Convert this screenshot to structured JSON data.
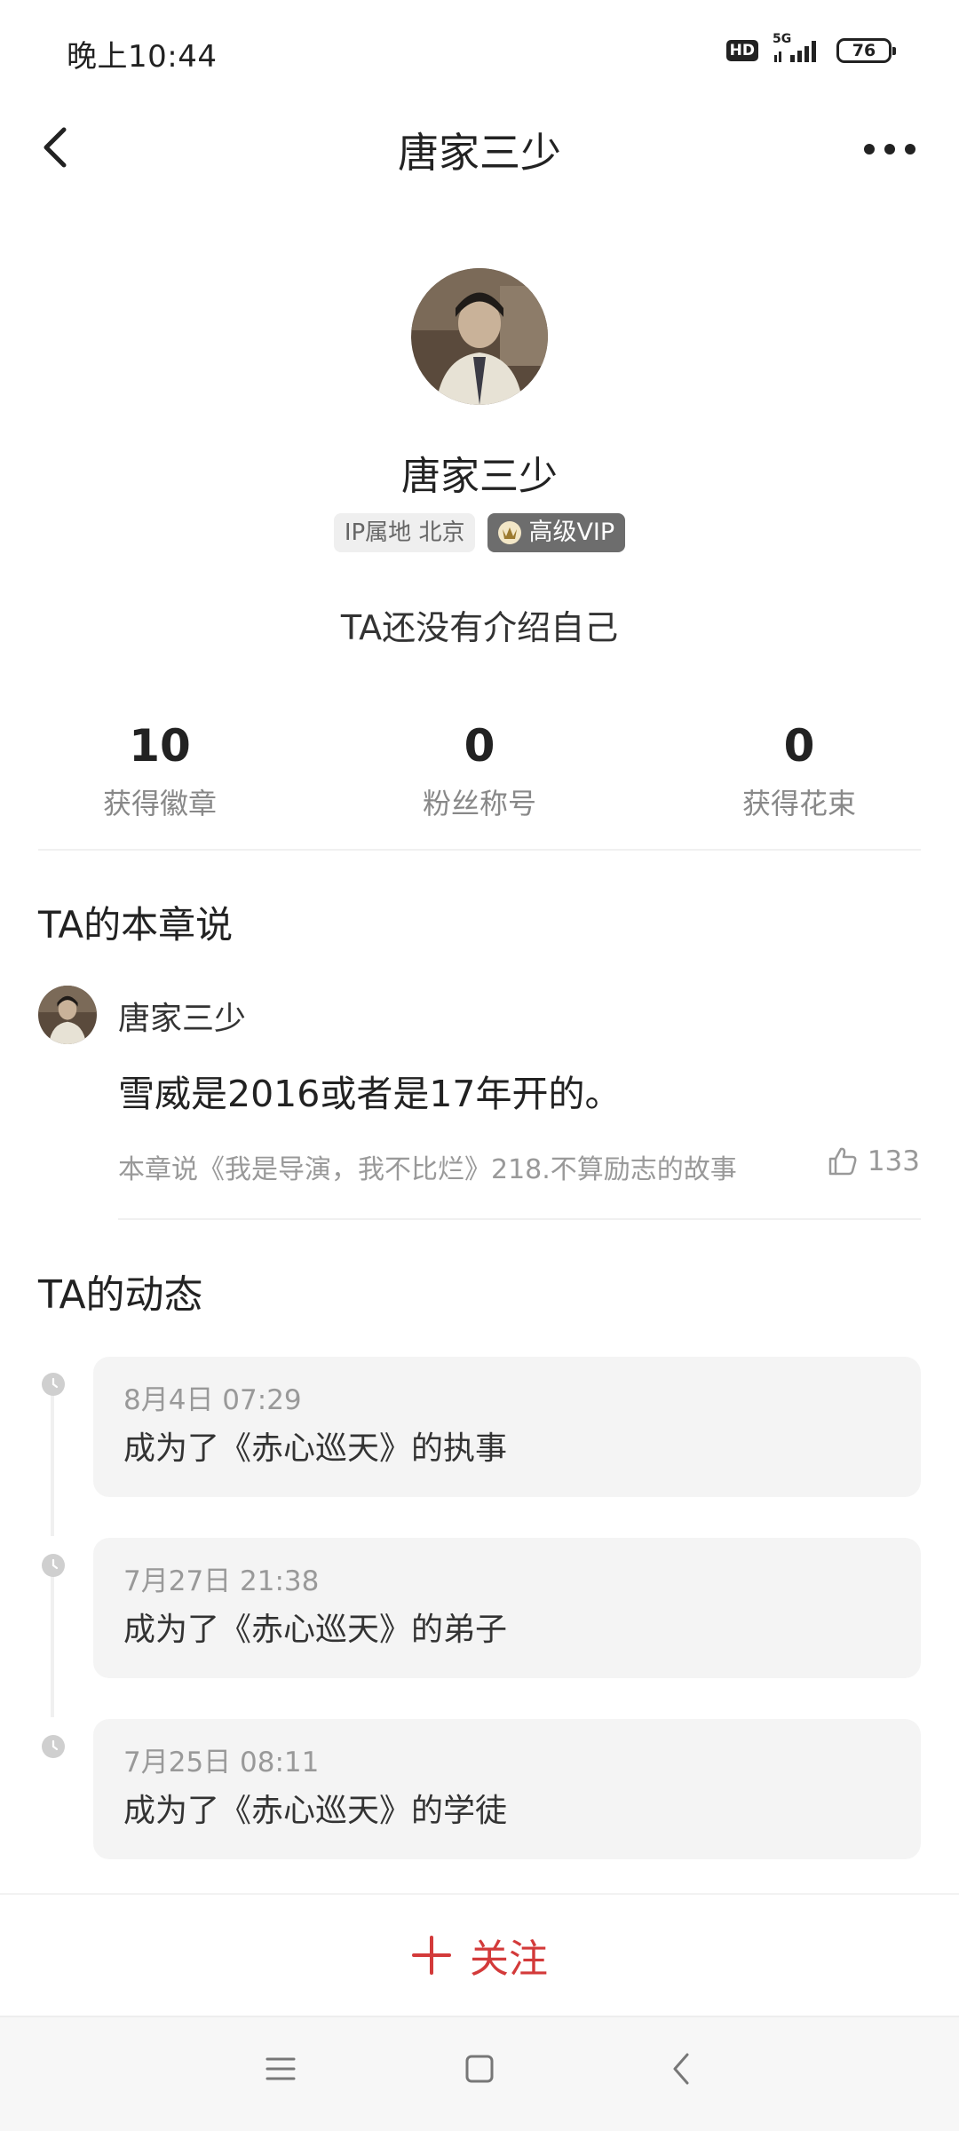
{
  "status_bar": {
    "time": "晚上10:44",
    "hd": "HD",
    "network": "5G",
    "battery": "76"
  },
  "nav": {
    "title": "唐家三少",
    "icons": [
      "back-icon",
      "more-icon"
    ]
  },
  "profile": {
    "name": "唐家三少",
    "ip_tag": "IP属地 北京",
    "vip_tag": "高级VIP",
    "bio": "TA还没有介绍自己"
  },
  "stats": [
    {
      "value": "10",
      "label": "获得徽章"
    },
    {
      "value": "0",
      "label": "粉丝称号"
    },
    {
      "value": "0",
      "label": "获得花束"
    }
  ],
  "chapter_comments": {
    "title": "TA的本章说",
    "user": "唐家三少",
    "text": "雪威是2016或者是17年开的。",
    "source": "本章说《我是导演，我不比烂》218.不算励志的故事",
    "likes": "133"
  },
  "activity": {
    "title": "TA的动态",
    "items": [
      {
        "time": "8月4日 07:29",
        "text": "成为了《赤心巡天》的执事"
      },
      {
        "time": "7月27日 21:38",
        "text": "成为了《赤心巡天》的弟子"
      },
      {
        "time": "7月25日 08:11",
        "text": "成为了《赤心巡天》的学徒"
      }
    ]
  },
  "follow": {
    "label": "关注"
  },
  "colors": {
    "accent": "#d33a3a",
    "vip_badge": "#6d6d6d"
  }
}
